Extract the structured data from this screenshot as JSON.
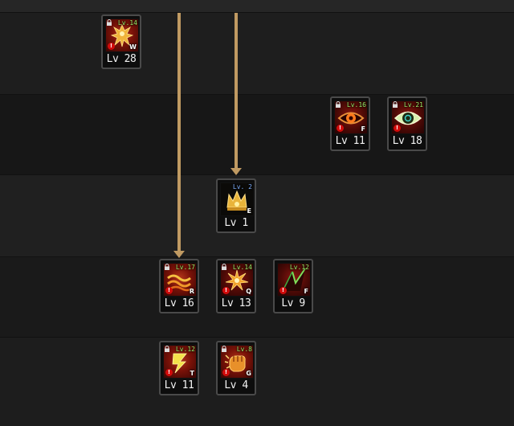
{
  "skills": [
    {
      "level": "Lv 28",
      "req": "Lv.14",
      "hotkey": "W",
      "icon": "spiky-figure-icon"
    },
    {
      "level": "Lv 11",
      "req": "Lv.16",
      "hotkey": "F",
      "icon": "evil-eye-icon"
    },
    {
      "level": "Lv 18",
      "req": "Lv.21",
      "hotkey": "",
      "icon": "green-eye-icon"
    },
    {
      "level": "Lv 1",
      "req": "Lv. 2",
      "hotkey": "E",
      "icon": "golden-crown-icon"
    },
    {
      "level": "Lv 16",
      "req": "Lv.17",
      "hotkey": "R",
      "icon": "flame-wave-icon"
    },
    {
      "level": "Lv 13",
      "req": "Lv.14",
      "hotkey": "Q",
      "icon": "burst-star-icon"
    },
    {
      "level": "Lv 9",
      "req": "Lv.12",
      "hotkey": "F",
      "icon": "green-spike-icon"
    },
    {
      "level": "Lv 11",
      "req": "Lv.12",
      "hotkey": "T",
      "icon": "lightning-bolt-icon"
    },
    {
      "level": "Lv 4",
      "req": "Lv.8",
      "hotkey": "G",
      "icon": "fist-strike-icon"
    }
  ],
  "colors": {
    "arrow": "#c09a62",
    "slot_border": "#4a4a4a",
    "requirement_text": "#9bef6a",
    "level_text": "#f2f2f2"
  }
}
